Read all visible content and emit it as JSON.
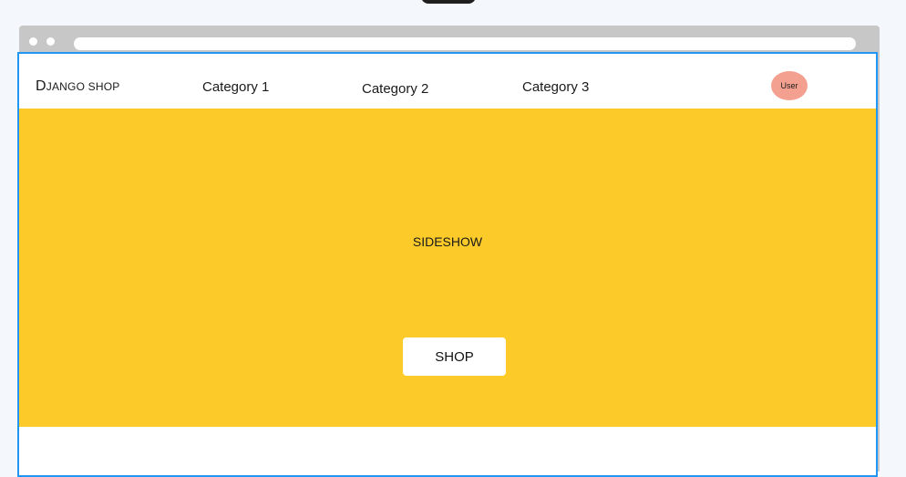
{
  "navbar": {
    "brand_initial": "D",
    "brand_rest": "JANGO SHOP",
    "links": [
      "Category 1",
      "Category 2",
      "Category 3"
    ],
    "user_label": "User"
  },
  "hero": {
    "title": "SIDESHOW",
    "button_label": "SHOP"
  },
  "colors": {
    "hero_background": "#fdcb29",
    "avatar_background": "#f4a090",
    "viewport_border": "#2196f3"
  }
}
